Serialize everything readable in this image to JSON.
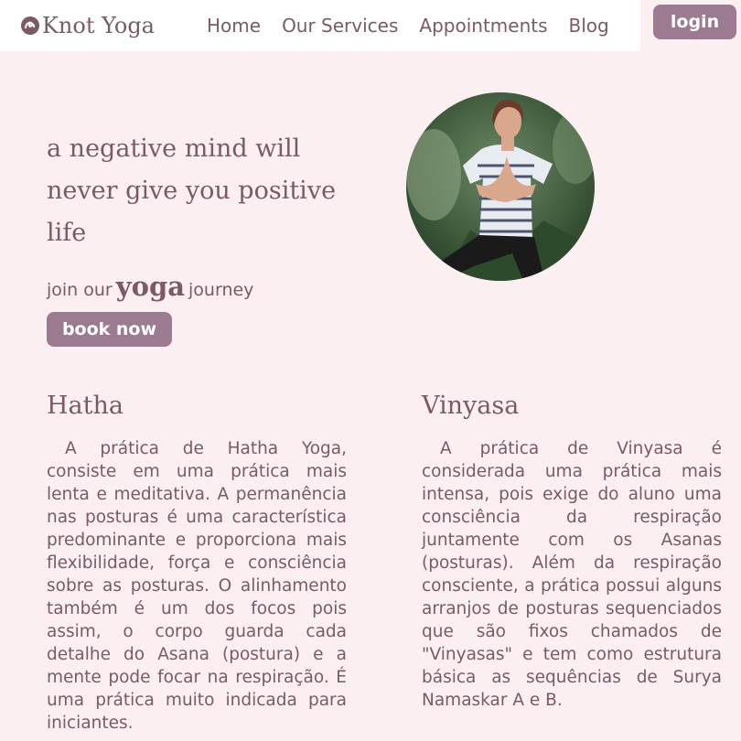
{
  "brand": {
    "name": "Knot Yoga",
    "icon": "knot-logo-icon"
  },
  "nav": {
    "links": [
      "Home",
      "Our Services",
      "Appointments",
      "Blog"
    ],
    "login_label": "login"
  },
  "hero": {
    "quote": "a negative mind will never give you positive life",
    "join_prefix": "join our",
    "join_highlight": "yoga",
    "join_suffix": "journey",
    "cta_label": "book now",
    "photo": "woman-yoga-tree-pose-photo"
  },
  "cards": [
    {
      "title": "Hatha",
      "text": "A prática de Hatha Yoga, consiste em uma prática mais lenta e meditativa. A permanência nas posturas é uma característica predominante e proporciona mais flexibilidade, força e consciência sobre as posturas. O alinhamento também é um dos focos pois assim, o corpo guarda cada detalhe do Asana (postura) e a mente pode focar na respiração. É uma prática muito indicada para iniciantes."
    },
    {
      "title": "Vinyasa",
      "text": "A prática de Vinyasa é considerada uma prática mais intensa, pois exige do aluno uma consciência da respiração juntamente com os Asanas (posturas). Além da respiração consciente, a prática possui alguns arranjos de posturas sequenciados que são fixos chamados de \"Vinyasas\" e tem como estrutura básica as sequências de Surya Namaskar A e B."
    }
  ],
  "colors": {
    "background": "#fbeff2",
    "accent": "#9c7b91",
    "text": "#7a5a66"
  }
}
